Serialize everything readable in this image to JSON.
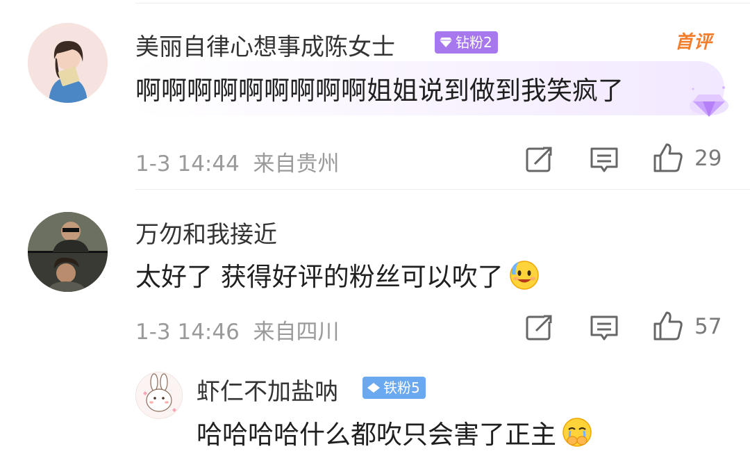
{
  "comments": [
    {
      "username": "美丽自律心想事成陈女士",
      "badge": "钻粉2",
      "first_review": "首评",
      "content": "啊啊啊啊啊啊啊啊啊姐姐说到做到我笑疯了",
      "time": "1-3 14:44",
      "location": "来自贵州",
      "likes": "29"
    },
    {
      "username": "万勿和我接近",
      "content": "太好了 获得好评的粉丝可以吹了",
      "emoji": "sweating-smile-emoji",
      "time": "1-3 14:46",
      "location": "来自四川",
      "likes": "57"
    },
    {
      "username": "虾仁不加盐呐",
      "badge": "铁粉5",
      "content": "哈哈哈哈什么都吹只会害了正主",
      "emoji": "crying-covering-mouth-emoji"
    }
  ],
  "icons": {
    "share": "share-icon",
    "reply": "reply-icon",
    "like": "thumbs-up-icon",
    "diamond": "diamond-icon"
  },
  "colors": {
    "diamond_badge": "#a777ee",
    "iron_badge": "#6aa8f0",
    "first_review": "#f27d2d",
    "meta_text": "#9a9a9a"
  }
}
